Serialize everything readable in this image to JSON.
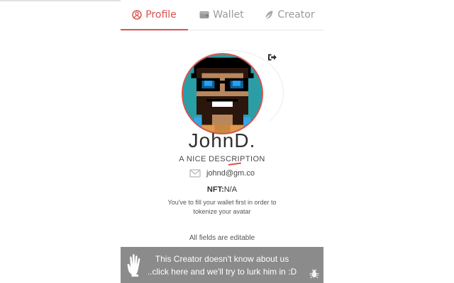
{
  "tabs": {
    "profile": {
      "label": "Profile",
      "icon": "user-circle-icon"
    },
    "wallet": {
      "label": "Wallet",
      "icon": "wallet-icon"
    },
    "creator": {
      "label": "Creator",
      "icon": "feather-icon"
    }
  },
  "profile": {
    "name": "JohnD.",
    "description": "A NICE DESCRIPTION",
    "email": "johnd@gm.co",
    "nft_label": "NFT:",
    "nft_value": "N/A",
    "wallet_message_line1": "You've to fill your wallet first in order to",
    "wallet_message_line2": "tokenize your avatar",
    "editable_note": "All fields are editable"
  },
  "icons": {
    "logout": "logout-icon",
    "mail": "mail-icon",
    "hand": "hand-icon",
    "bug": "bug-icon"
  },
  "banner": {
    "line1": "This Creator doesn't know about us",
    "line2": "..click here and we'll try to lurk him in :D"
  },
  "colors": {
    "accent": "#d9534f",
    "banner": "#8b8b8b",
    "tab_inactive": "#9a9a9a"
  }
}
